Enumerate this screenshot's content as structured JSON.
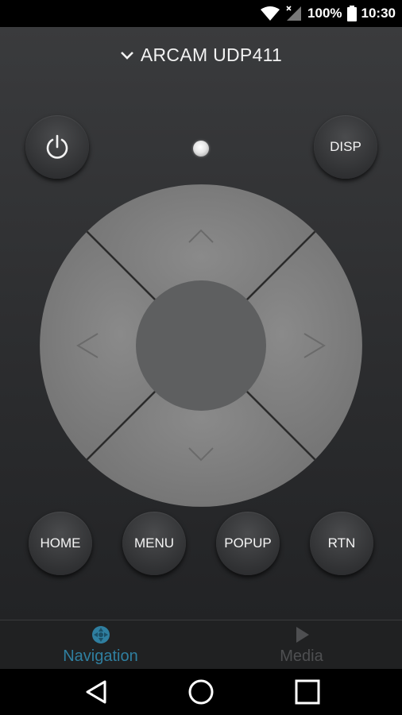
{
  "status_bar": {
    "battery_text": "100%",
    "time": "10:30",
    "icons": [
      "wifi-icon",
      "signal-icon",
      "battery-icon"
    ]
  },
  "device": {
    "name": "ARCAM UDP411"
  },
  "remote": {
    "power_icon": "power-icon",
    "disp_label": "DISP",
    "dpad_icons": [
      "arrow-up-icon",
      "arrow-left-icon",
      "arrow-right-icon",
      "arrow-down-icon"
    ],
    "bottom_buttons": [
      "HOME",
      "MENU",
      "POPUP",
      "RTN"
    ]
  },
  "tabs": [
    {
      "label": "Navigation",
      "icon": "navigation-icon",
      "active": true
    },
    {
      "label": "Media",
      "icon": "play-icon",
      "active": false
    }
  ],
  "colors": {
    "accent": "#2f7fa0",
    "inactive_tab": "#4e4f51",
    "dpad_ring": "#7d7d7d",
    "dpad_center": "#5e5f60"
  }
}
